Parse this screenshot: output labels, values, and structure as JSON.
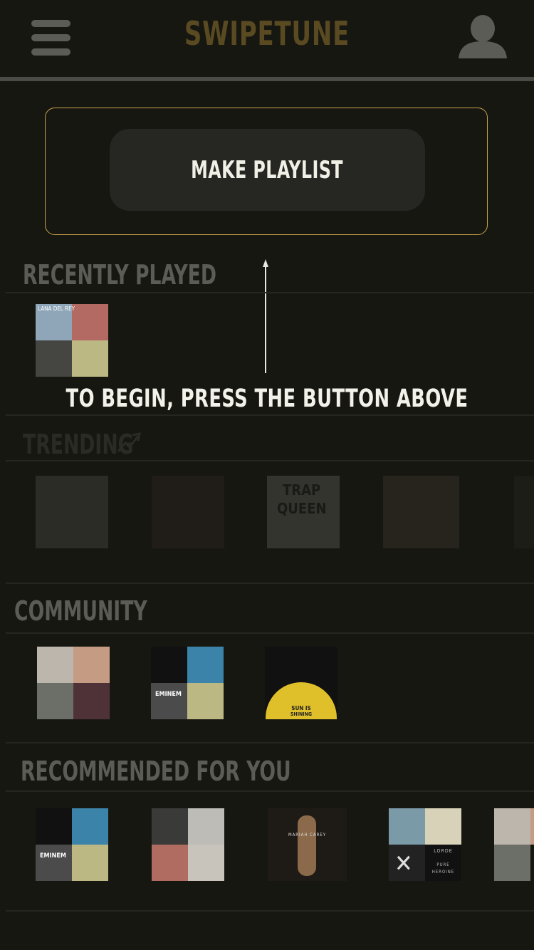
{
  "header": {
    "title": "SWIPETUNE",
    "menu_icon": "hamburger-menu-icon",
    "profile_icon": "user-icon"
  },
  "cta": {
    "label": "MAKE PLAYLIST"
  },
  "onboarding": {
    "tip": "TO BEGIN, PRESS THE BUTTON ABOVE"
  },
  "sections": {
    "recently_played": {
      "title": "RECENTLY PLAYED",
      "cover_texts": [
        "LANA DEL REY"
      ]
    },
    "trending": {
      "title": "TRENDING",
      "icon": "trending-up-icon",
      "cover_texts": [
        "TRAP",
        "QUEEN"
      ]
    },
    "community": {
      "title": "COMMUNITY",
      "cover_texts": [
        "EMINEM",
        "SUN IS",
        "SHINING"
      ]
    },
    "recommended": {
      "title": "RECOMMENDED FOR YOU",
      "cover_texts": [
        "EMINEM",
        "MARIAH CAREY",
        "LORDE",
        "PURE",
        "HEROINE"
      ]
    }
  },
  "colors": {
    "background": "#171712",
    "accent_gold": "#c8a24a",
    "title_brown": "#5a4a22"
  }
}
